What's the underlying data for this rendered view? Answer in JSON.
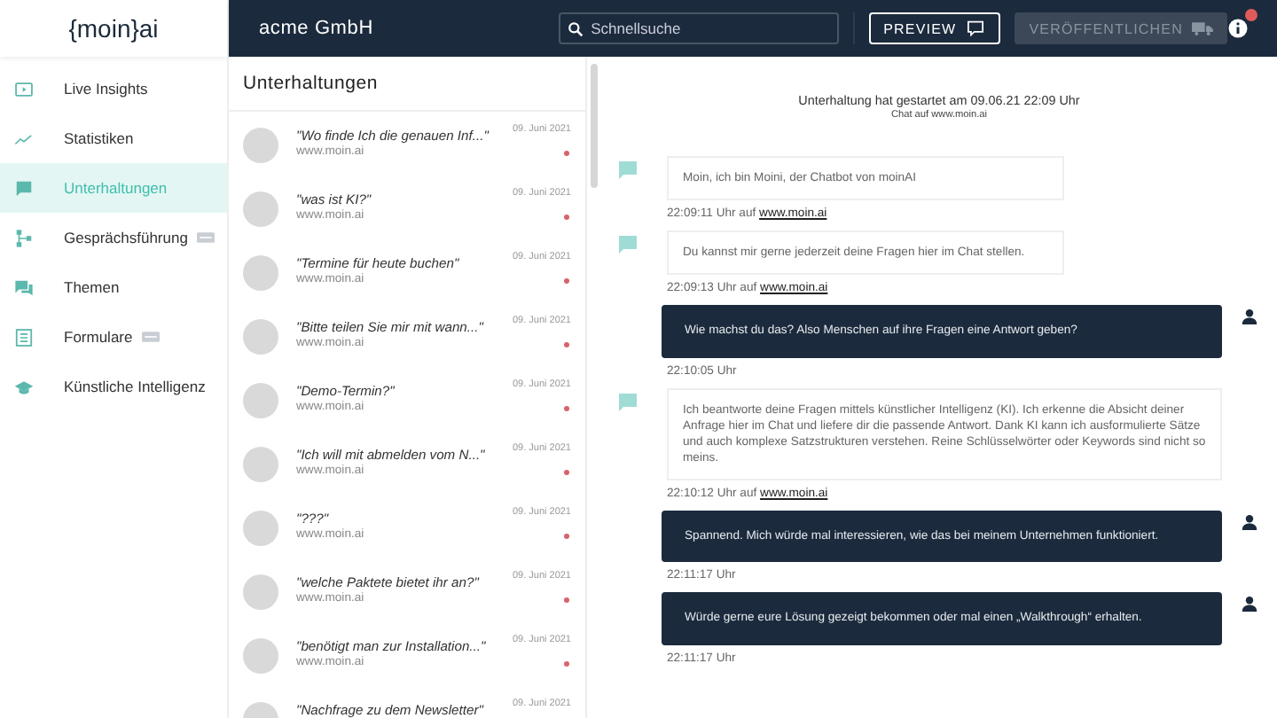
{
  "logo": "{moin}ai",
  "header": {
    "company": "acme GmbH",
    "search": {
      "placeholder": "Schnellsuche"
    },
    "preview_button": "PREVIEW",
    "publish_button": {
      "label": "VERÖFFENTLICHEN",
      "disabled": true
    },
    "notification_badge": true
  },
  "sidebar": {
    "items": [
      {
        "label": "Live Insights",
        "kind": "tv",
        "selected": false,
        "beta_badge": false
      },
      {
        "label": "Statistiken",
        "kind": "chart",
        "selected": false,
        "beta_badge": false
      },
      {
        "label": "Unterhaltungen",
        "kind": "chat",
        "selected": true,
        "beta_badge": false
      },
      {
        "label": "Gesprächsführung",
        "kind": "flow",
        "selected": false,
        "beta_badge": true
      },
      {
        "label": "Themen",
        "kind": "chats",
        "selected": false,
        "beta_badge": false
      },
      {
        "label": "Formulare",
        "kind": "form",
        "selected": false,
        "beta_badge": true
      },
      {
        "label": "Künstliche Intelligenz",
        "kind": "cap",
        "selected": false,
        "beta_badge": false
      }
    ]
  },
  "conversations": {
    "title": "Unterhaltungen",
    "items": [
      {
        "text": "\"Wo finde Ich die genauen Inf...\"",
        "source": "www.moin.ai",
        "date": "09. Juni 2021",
        "unread": true
      },
      {
        "text": "\"was ist KI?\"",
        "source": "www.moin.ai",
        "date": "09. Juni 2021",
        "unread": true
      },
      {
        "text": "\"Termine für heute buchen\"",
        "source": "www.moin.ai",
        "date": "09. Juni 2021",
        "unread": true
      },
      {
        "text": "\"Bitte teilen Sie mir mit wann...\"",
        "source": "www.moin.ai",
        "date": "09. Juni 2021",
        "unread": true
      },
      {
        "text": "\"Demo-Termin?\"",
        "source": "www.moin.ai",
        "date": "09. Juni 2021",
        "unread": true
      },
      {
        "text": "\"Ich will mit abmelden vom N...\"",
        "source": "www.moin.ai",
        "date": "09. Juni 2021",
        "unread": true
      },
      {
        "text": "\"???\"",
        "source": "www.moin.ai",
        "date": "09. Juni 2021",
        "unread": true
      },
      {
        "text": "\"welche Paktete bietet ihr an?\"",
        "source": "www.moin.ai",
        "date": "09. Juni 2021",
        "unread": true
      },
      {
        "text": "\"benötigt man zur Installation...\"",
        "source": "www.moin.ai",
        "date": "09. Juni 2021",
        "unread": true
      },
      {
        "text": "\"Nachfrage zu dem Newsletter\"",
        "date": "09. Juni 2021"
      }
    ]
  },
  "chat": {
    "started": "Unterhaltung hat gestartet am 09.06.21 22:09 Uhr",
    "channel": "Chat auf www.moin.ai",
    "messages": [
      {
        "kind": "bot",
        "text": "Moin, ich bin Moini, der Chatbot von moinAI",
        "time": "22:09:11 Uhr auf",
        "link": "www.moin.ai"
      },
      {
        "kind": "bot",
        "text": "Du kannst mir gerne jederzeit deine Fragen hier im Chat stellen.",
        "time": "22:09:13 Uhr auf",
        "link": "www.moin.ai"
      },
      {
        "kind": "user",
        "text": "Wie machst du das? Also Menschen auf ihre Fragen eine Antwort geben?",
        "time": "22:10:05 Uhr"
      },
      {
        "kind": "bot",
        "text": "Ich beantworte deine Fragen mittels künstlicher Intelligenz (KI). Ich erkenne die Absicht deiner Anfrage hier im Chat und liefere dir die passende Antwort. Dank KI kann ich ausformulierte Sätze und auch komplexe Satzstrukturen verstehen. Reine Schlüsselwörter oder Keywords sind nicht so meins.",
        "time": "22:10:12 Uhr auf",
        "link": "www.moin.ai",
        "wide": true
      },
      {
        "kind": "user",
        "text": "Spannend. Mich würde mal interessieren, wie das bei meinem Unternehmen funktioniert.",
        "time": "22:11:17 Uhr"
      },
      {
        "kind": "user",
        "text": "Würde gerne eure Lösung gezeigt bekommen oder mal einen „Walkthrough“ erhalten.",
        "time": "22:11:17 Uhr"
      }
    ]
  }
}
